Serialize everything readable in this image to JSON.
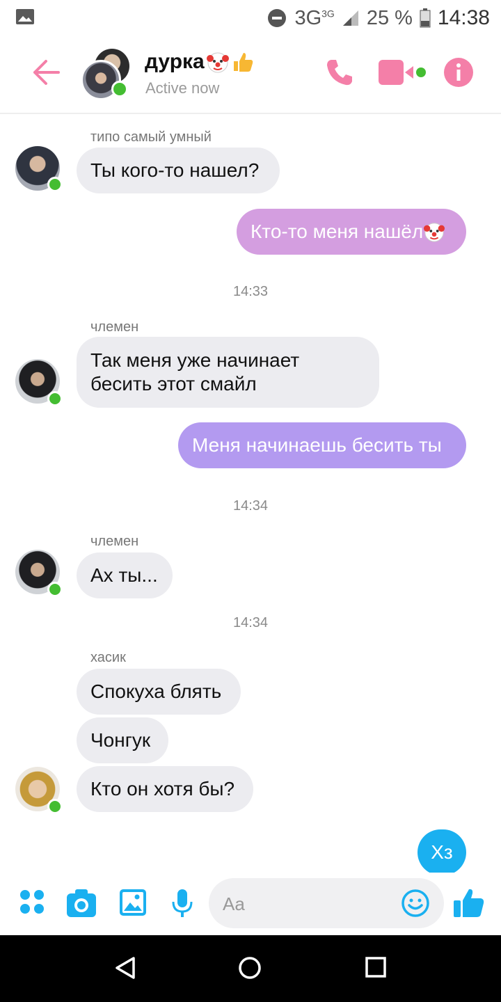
{
  "status_bar": {
    "network": "3G",
    "network_small": "3G",
    "battery": "25 %",
    "time": "14:38"
  },
  "header": {
    "title": "дурка",
    "subtitle": "Active now"
  },
  "messages": [
    {
      "sender": "типо самый умный",
      "text": "Ты кого-то нашел?",
      "direction": "incoming"
    },
    {
      "text": "Кто-то меня нашёл",
      "direction": "outgoing",
      "color": "#d49ee0"
    },
    {
      "timestamp": "14:33"
    },
    {
      "sender": "члемен",
      "line1": "Так меня уже начинает",
      "line2": "бесить этот смайл",
      "direction": "incoming"
    },
    {
      "text": "Меня начинаешь бесить ты",
      "direction": "outgoing",
      "color": "#b39af0"
    },
    {
      "timestamp": "14:34"
    },
    {
      "sender": "члемен",
      "text": "Ах ты...",
      "direction": "incoming"
    },
    {
      "timestamp": "14:34"
    },
    {
      "sender": "хасик",
      "text": "Спокуха блять",
      "direction": "incoming"
    },
    {
      "text": "Чонгук",
      "direction": "incoming"
    },
    {
      "text": "Кто он хотя бы?",
      "direction": "incoming"
    },
    {
      "text": "Хз",
      "direction": "outgoing",
      "color": "#1ab0f0"
    }
  ],
  "composer": {
    "placeholder": "Aa"
  },
  "colors": {
    "accent_pink": "#f47fa8",
    "online_green": "#44bd32",
    "composer_blue": "#1ab0f0"
  }
}
